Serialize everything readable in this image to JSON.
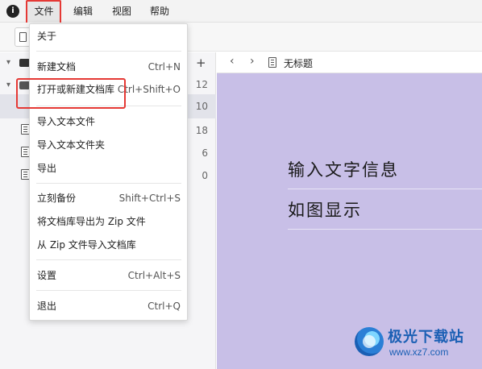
{
  "menubar": {
    "app_icon": "info-circle-icon",
    "items": [
      {
        "label": "文件"
      },
      {
        "label": "编辑"
      },
      {
        "label": "视图"
      },
      {
        "label": "帮助"
      }
    ]
  },
  "sidebar": {
    "add_label": "+",
    "counts": [
      "12",
      "10",
      "18",
      "6",
      "0"
    ]
  },
  "dropdown": {
    "items": [
      {
        "label": "关于",
        "shortcut": ""
      },
      {
        "label": "新建文档",
        "shortcut": "Ctrl+N"
      },
      {
        "label": "打开或新建文档库",
        "shortcut": "Ctrl+Shift+O"
      },
      {
        "label": "导入文本文件",
        "shortcut": ""
      },
      {
        "label": "导入文本文件夹",
        "shortcut": ""
      },
      {
        "label": "导出",
        "shortcut": ""
      },
      {
        "label": "立刻备份",
        "shortcut": "Shift+Ctrl+S"
      },
      {
        "label": "将文档库导出为 Zip 文件",
        "shortcut": ""
      },
      {
        "label": "从 Zip 文件导入文档库",
        "shortcut": ""
      },
      {
        "label": "设置",
        "shortcut": "Ctrl+Alt+S"
      },
      {
        "label": "退出",
        "shortcut": "Ctrl+Q"
      }
    ]
  },
  "editor": {
    "back": "‹",
    "forward": "›",
    "doc_title": "无标题",
    "lines": [
      "输入文字信息",
      "如图显示"
    ],
    "background": "#c8bfe7"
  },
  "watermark": {
    "name": "极光下载站",
    "url": "www.xz7.com"
  },
  "colors": {
    "highlight_red": "#e53935",
    "selected_row": "#e2e3ea"
  }
}
